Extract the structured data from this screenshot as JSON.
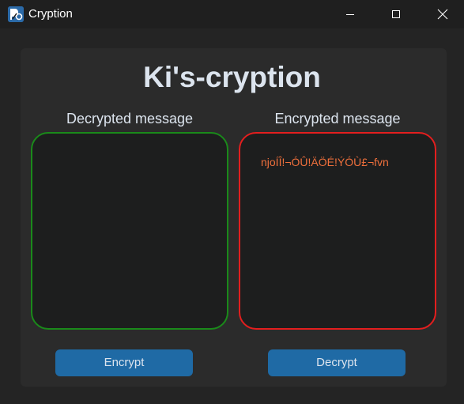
{
  "window": {
    "title": "Cryption",
    "icon": "app-logo-icon",
    "controls": [
      "minimize-icon",
      "maximize-icon",
      "close-icon"
    ]
  },
  "main": {
    "heading": "Ki's-cryption",
    "decrypted": {
      "label": "Decrypted message",
      "value": ""
    },
    "encrypted": {
      "label": "Encrypted message",
      "value": "njoÍÎ!¬ÓÛ!ÄÖÉ!ÝÓÙ£¬fvn"
    },
    "buttons": {
      "encrypt": "Encrypt",
      "decrypt": "Decrypt"
    }
  },
  "colors": {
    "accent": "#1f6aa5",
    "decrypted_border": "#1a8a1a",
    "encrypted_border": "#e31e1e",
    "encrypted_text": "#f0703c"
  }
}
